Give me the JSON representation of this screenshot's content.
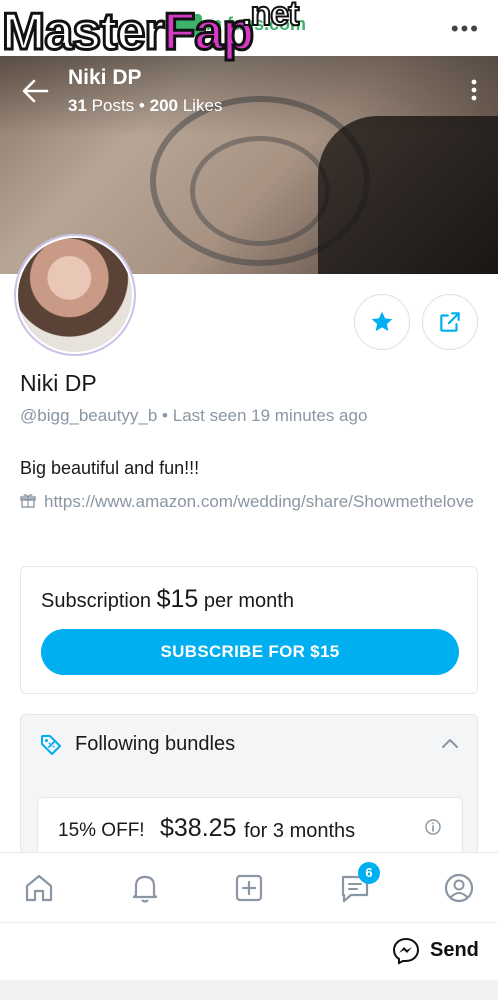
{
  "watermark": {
    "part1": "Master",
    "part2": "Fap",
    "part3": ".net"
  },
  "browser": {
    "url_text": "m fans.com"
  },
  "profile": {
    "display_name": "Niki DP",
    "posts_count": "31",
    "posts_label": "Posts",
    "likes_count": "200",
    "likes_label": "Likes",
    "separator": "•",
    "name": "Niki DP",
    "handle": "@bigg_beautyy_b",
    "last_seen": "Last seen 19 minutes ago",
    "bio": "Big beautiful and fun!!!",
    "link": "https://www.amazon.com/wedding/share/Showmethelove"
  },
  "subscription": {
    "label": "Subscription",
    "price": "$15",
    "period": "per month",
    "button_label": "SUBSCRIBE FOR $15",
    "accent_color": "#00aff0"
  },
  "bundles": {
    "title": "Following bundles",
    "items": [
      {
        "discount": "15% OFF!",
        "price": "$38.25",
        "period": "for 3 months"
      }
    ]
  },
  "bottom_nav": {
    "items": [
      {
        "icon": "home-icon"
      },
      {
        "icon": "bell-icon"
      },
      {
        "icon": "add-post-icon"
      },
      {
        "icon": "messages-icon",
        "badge": "6"
      },
      {
        "icon": "profile-icon"
      }
    ]
  },
  "messenger": {
    "send_label": "Send"
  }
}
